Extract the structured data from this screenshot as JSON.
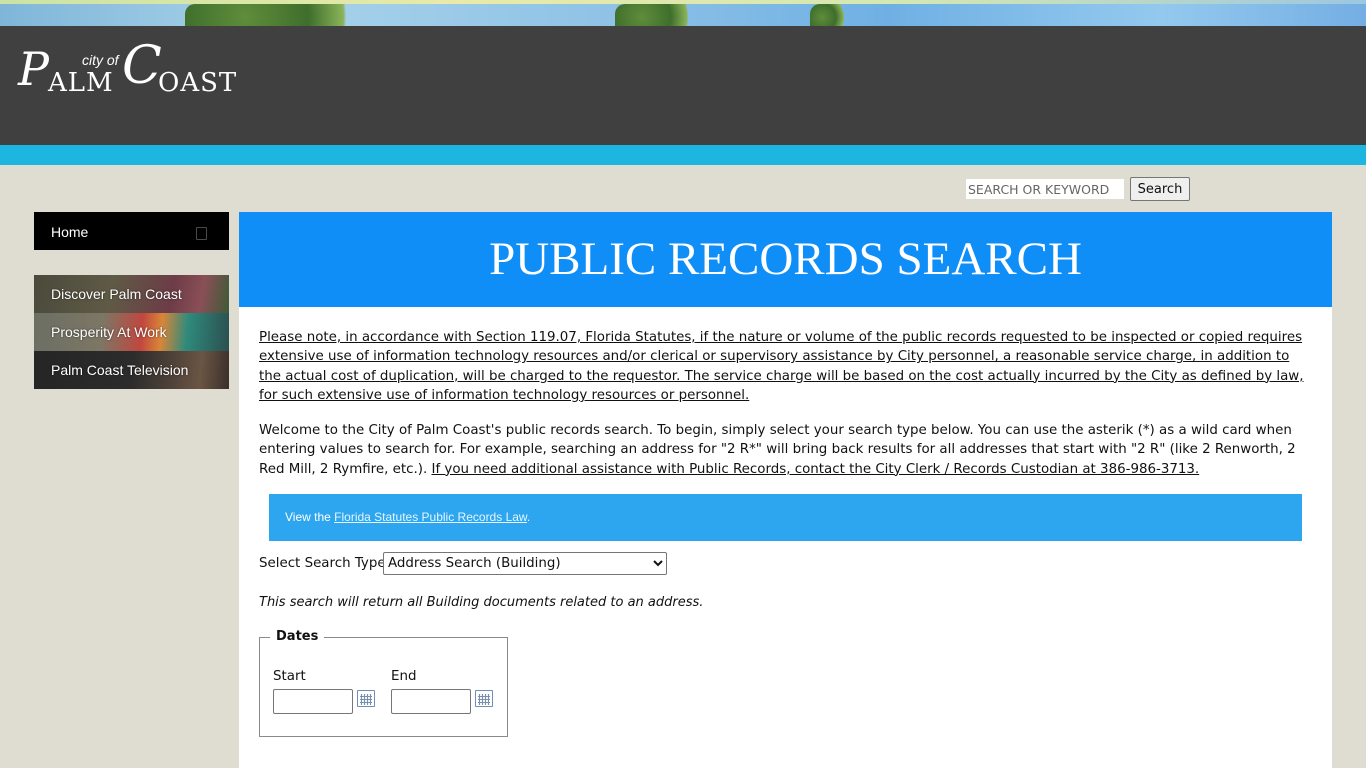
{
  "header": {
    "logo": {
      "city_of": "city of",
      "word1_initial": "P",
      "word1_rest": "ALM",
      "word2_initial": "C",
      "word2_rest": "OAST"
    }
  },
  "site_search": {
    "placeholder": "SEARCH OR KEYWORD",
    "button_label": "Search"
  },
  "sidebar": {
    "home_label": "Home",
    "features": [
      {
        "label": "Discover Palm Coast"
      },
      {
        "label": "Prosperity At Work"
      },
      {
        "label": "Palm Coast Television"
      }
    ]
  },
  "main": {
    "title": "PUBLIC RECORDS SEARCH",
    "notice": "Please note, in accordance with Section 119.07, Florida Statutes, if the nature or volume of the public records requested to be inspected or copied requires extensive use of information technology resources and/or clerical or supervisory assistance by City personnel, a reasonable service charge, in addition to the actual cost of duplication, will be charged to the requestor. The service charge will be based on the cost actually incurred by the City as defined by law, for such extensive use of information technology resources or personnel.",
    "welcome_text": "Welcome to the City of Palm Coast's public records search. To begin, simply select your search type below. You can use the asterik (*) as a wild card when entering values to search for. For example, searching an address for \"2 R*\" will bring back results for all addresses that start with \"2 R\" (like 2 Renworth, 2 Red Mill, 2 Rymfire, etc.).",
    "welcome_link": "If you need additional assistance with Public Records, contact the City Clerk / Records Custodian at 386-986-3713.",
    "info_prefix": "View the",
    "info_link": "Florida Statutes Public Records Law",
    "info_suffix": ".",
    "search_type_label": "Select Search Type",
    "search_type_selected": "Address Search (Building)",
    "search_description": "This search will return all Building documents related to an address.",
    "dates": {
      "legend": "Dates",
      "start_label": "Start",
      "end_label": "End",
      "start_value": "",
      "end_value": ""
    }
  },
  "colors": {
    "banner_blue": "#0f8ef7",
    "info_blue": "#2ea6ef",
    "header_dark": "#404040",
    "header_band": "#1cb6e0",
    "page_bg": "#dfdcd1"
  }
}
